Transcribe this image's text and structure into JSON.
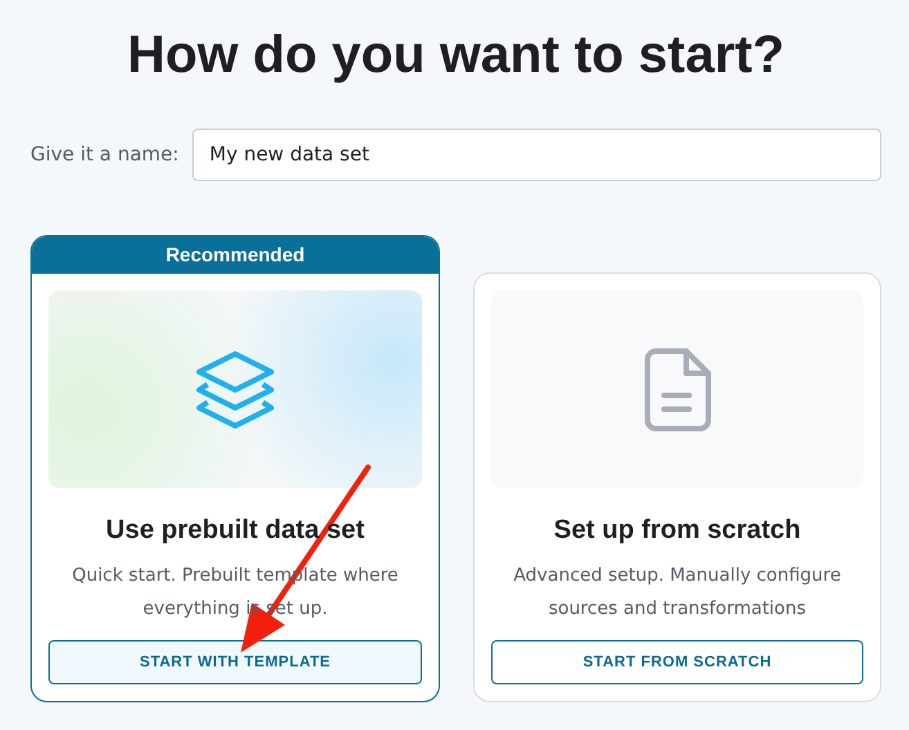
{
  "title": "How do you want to start?",
  "name_field": {
    "label": "Give it a name:",
    "value": "My new data set"
  },
  "options": [
    {
      "badge": "Recommended",
      "kind": "template",
      "heading": "Use prebuilt data set",
      "description": "Quick start. Prebuilt template where everything is set up.",
      "button": "START WITH TEMPLATE",
      "recommended": true
    },
    {
      "kind": "scratch",
      "heading": "Set up from scratch",
      "description": "Advanced setup. Manually configure sources and transformations",
      "button": "START FROM SCRATCH",
      "recommended": false
    }
  ]
}
